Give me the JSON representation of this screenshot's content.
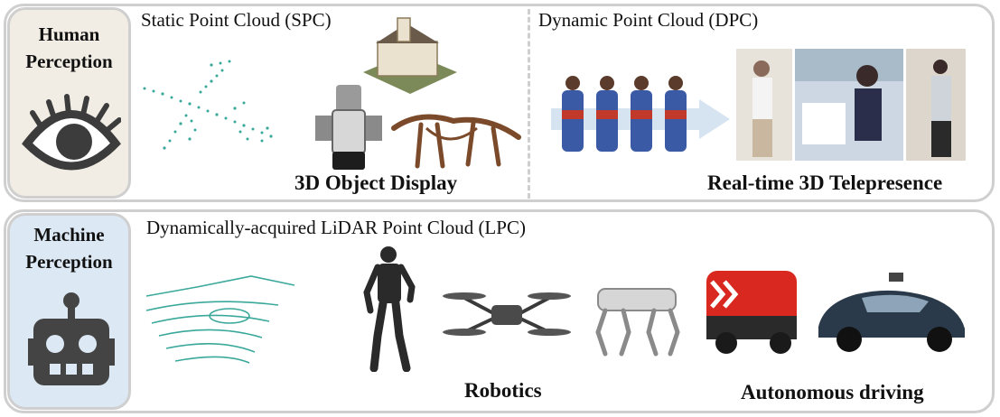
{
  "human": {
    "label_line1": "Human",
    "label_line2": "Perception",
    "icon": "eye-icon",
    "tag_color": "#f1ede4",
    "spc": {
      "title": "Static Point Cloud (SPC)",
      "caption": "3D Object Display"
    },
    "dpc": {
      "title": "Dynamic Point Cloud (DPC)",
      "caption": "Real-time 3D Telepresence"
    }
  },
  "machine": {
    "label_line1": "Machine",
    "label_line2": "Perception",
    "icon": "robot-icon",
    "tag_color": "#dce8f4",
    "lpc": {
      "title": "Dynamically-acquired LiDAR Point Cloud (LPC)",
      "caption_robotics": "Robotics",
      "caption_driving": "Autonomous driving"
    }
  },
  "colors": {
    "border": "#cfcfcf",
    "point_cloud": "#3aa89a",
    "vehicle_red": "#d8281f",
    "car_body": "#2a3a4a"
  }
}
